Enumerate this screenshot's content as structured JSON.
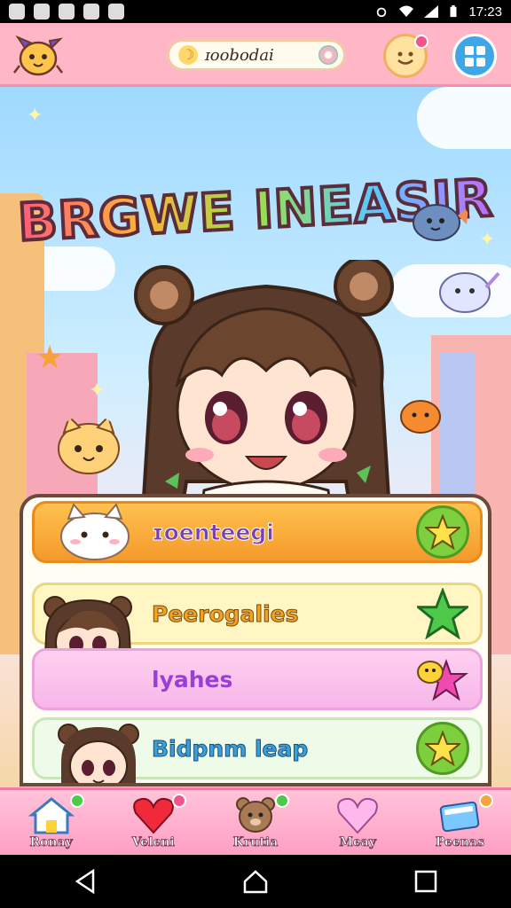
{
  "status_bar": {
    "time": "17:23"
  },
  "top_bar": {
    "search_text": "ɪoobodai",
    "search_icon": "crescent-icon"
  },
  "title": {
    "text": "BRGWE INEASIR"
  },
  "menu": {
    "items": [
      {
        "label": "ɪoenteegi",
        "icon": "star-button-icon",
        "accent": "#f49a2c"
      },
      {
        "label": "Peerogalies",
        "icon": "star-button-icon",
        "accent": "#fff6c4"
      },
      {
        "label": "lyahes",
        "icon": "star-button-icon",
        "accent": "#f7b6ea"
      },
      {
        "label": "Bidpnm leap",
        "icon": "star-button-icon",
        "accent": "#eefbe9"
      }
    ]
  },
  "bottom_nav": {
    "items": [
      {
        "label": "Ronay",
        "icon": "house-icon"
      },
      {
        "label": "Veleni",
        "icon": "heart-icon"
      },
      {
        "label": "Krutia",
        "icon": "bear-icon"
      },
      {
        "label": "Meay",
        "icon": "pink-heart-icon"
      },
      {
        "label": "Peenas",
        "icon": "card-icon"
      }
    ]
  },
  "colors": {
    "top_bar": "#ffb6c6",
    "bottom_nav": "#ff9fc3",
    "panel_border": "#6b4a3c"
  }
}
